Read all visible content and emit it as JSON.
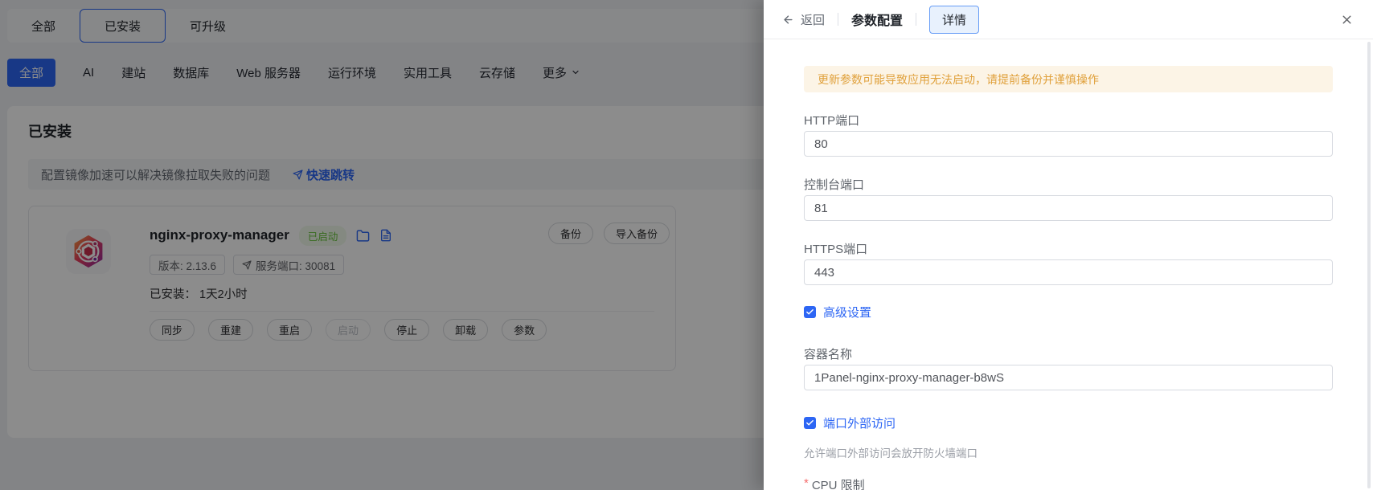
{
  "app_store": {
    "top_tabs": [
      {
        "label": "全部",
        "active": false
      },
      {
        "label": "已安装",
        "active": true
      },
      {
        "label": "可升级",
        "active": false
      }
    ],
    "category_tabs": [
      "全部",
      "AI",
      "建站",
      "数据库",
      "Web 服务器",
      "运行环境",
      "实用工具",
      "云存储"
    ],
    "more_tab": "更多",
    "section_title": "已安装",
    "notice": {
      "text": "配置镜像加速可以解决镜像拉取失败的问题",
      "link": "快速跳转"
    },
    "app_card": {
      "name": "nginx-proxy-manager",
      "status": "已启动",
      "version_label": "版本: 2.13.6",
      "port_label": "服务端口: 30081",
      "installed_label": "已安装： 1天2小时",
      "actions": [
        "同步",
        "重建",
        "重启",
        "启动",
        "停止",
        "卸载",
        "参数"
      ],
      "disabled_action": "启动",
      "header_actions": [
        "备份",
        "导入备份"
      ]
    }
  },
  "drawer": {
    "back_label": "返回",
    "title": "参数配置",
    "detail_button": "详情",
    "warning": "更新参数可能导致应用无法启动，请提前备份并谨慎操作",
    "fields": [
      {
        "label": "HTTP端口",
        "value": "80"
      },
      {
        "label": "控制台端口",
        "value": "81"
      },
      {
        "label": "HTTPS端口",
        "value": "443"
      }
    ],
    "advanced_checkbox": "高级设置",
    "container_name": {
      "label": "容器名称",
      "value": "1Panel-nginx-proxy-manager-b8wS"
    },
    "port_external_checkbox": "端口外部访问",
    "port_external_hint": "允许端口外部访问会放开防火墙端口",
    "cpu_limit_label": "CPU 限制",
    "required_marker": "*"
  },
  "icons": {
    "back": "arrow-left-icon",
    "close": "close-icon",
    "folder": "folder-icon",
    "log": "file-text-icon",
    "send": "send-icon",
    "chevron": "chevron-down-icon",
    "check": "check-icon"
  },
  "colors": {
    "primary": "#2d66f4",
    "success_text": "#67c23a",
    "success_bg": "#f0f9eb",
    "warning_text": "#e0a13c",
    "warning_bg": "#fcf4e6",
    "danger": "#f56c6c"
  }
}
